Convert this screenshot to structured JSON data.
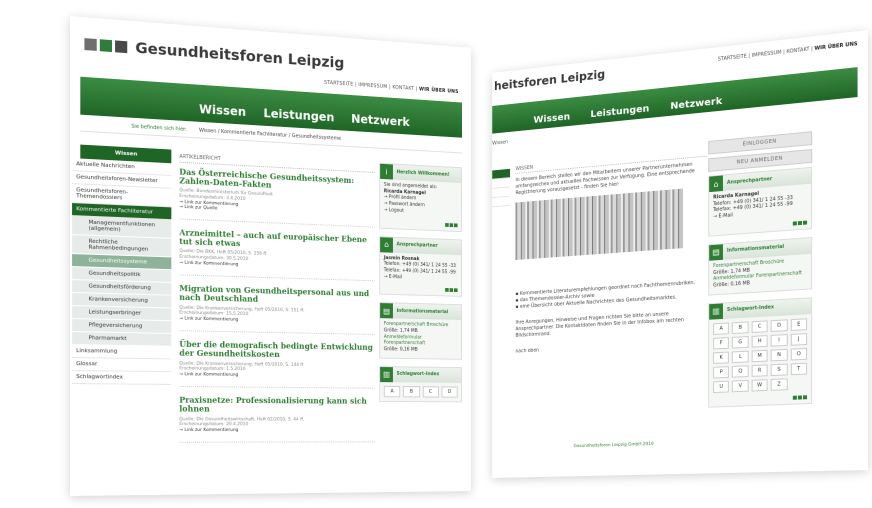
{
  "left": {
    "brand": "Gesundheitsforen Leipzig",
    "topnav": [
      "STARTSEITE",
      "IMPRESSUM",
      "KONTAKT",
      "WIR ÜBER UNS"
    ],
    "tabs": [
      "Wissen",
      "Leistungen",
      "Netzwerk"
    ],
    "crumb_label": "Sie befinden sich hier:",
    "crumb_path": "Wissen / Kommentierte Fachliteratur / Gesundheitssysteme",
    "nav_head": "Wissen",
    "nav": {
      "aktuelle": "Aktuelle Nachrichten",
      "newsletter": "Gesundheitsforen-Newsletter",
      "themen": "Gesundheitsforen-Themendossiers",
      "fachlit": "Kommentierte Fachliteratur",
      "sub1": "Managementfunktionen (allgemein)",
      "sub2": "Rechtliche Rahmenbedingungen",
      "sub3": "Gesundheitssysteme",
      "sub4": "Gesundheitspolitik",
      "sub5": "Gesundheitsförderung",
      "sub6": "Krankenversicherung",
      "sub7": "Leistungserbringer",
      "sub8": "Pflegeversicherung",
      "sub9": "Pharmamarkt",
      "links": "Linksammlung",
      "glossar": "Glossar",
      "schlagwort": "Schlagwortindex"
    },
    "section_label": "ARTIKELBERICHT",
    "articles": [
      {
        "title": "Das Österreichische Gesundheitssystem: Zahlen-Daten-Fakten",
        "meta": "Quelle: Bundesministerium für Gesundheit",
        "date": "Erscheinungsdatum: 3.4.2010",
        "link1": "Link zur Kommentierung",
        "link2": "Link zur Quelle"
      },
      {
        "title": "Arzneimittel – auch auf europäischer Ebene tut sich etwas",
        "meta": "Quelle: Die BKK, Heft 05/2010, S. 256 ff.",
        "date": "Erscheinungsdatum: 30.5.2010",
        "link1": "Link zur Kommentierung"
      },
      {
        "title": "Migration von Gesundheitspersonal aus und nach Deutschland",
        "meta": "Quelle: Die Krankenversicherung, Heft 05/2010, S. 151 ff.",
        "date": "Erscheinungsdatum: 15.5.2010",
        "link1": "Link zur Kommentierung"
      },
      {
        "title": "Über die demografisch bedingte Entwicklung der Gesundheitskosten",
        "meta": "Quelle: Die Krankenversicherung, Heft 05/2010, S. 144 ff.",
        "date": "Erscheinungsdatum: 1.5.2010",
        "link1": "Link zur Kommentierung"
      },
      {
        "title": "Praxisnetze: Professionalisierung kann sich lohnen",
        "meta": "Quelle: Die Gesundheitswirtschaft, Heft 02/2010, S. 44 ff.",
        "date": "Erscheinungsdatum: 20.4.2010",
        "link1": "Link zur Kommentierung"
      }
    ],
    "welcome": {
      "title": "Herzlich Willkommen!",
      "line1": "Sie sind angemeldet als:",
      "name": "Ricarda Karnagel",
      "p1": "Profil ändern",
      "p2": "Passwort ändern",
      "p3": "Logout"
    },
    "contact": {
      "title": "Ansprechpartner",
      "name": "Jasmin Rosnak",
      "tel": "Telefon: +49 (0) 341/ 1 24 55 -33",
      "fax": "Telefax: +49 (0) 341/ 1 24 55 -99",
      "mail": "E-Mail"
    },
    "info": {
      "title": "Informationsmaterial",
      "d1": "Forenpartnerschaft Broschüre",
      "s1": "Größe: 1,74 MB",
      "d2": "Anmeldeformular Forenpartnerschaft",
      "s2": "Größe: 0,16 MB"
    },
    "index": {
      "title": "Schlagwort-Index",
      "letters": [
        "A",
        "B",
        "C",
        "D"
      ]
    }
  },
  "right": {
    "brand": "heitsforen Leipzig",
    "topnav": [
      "STARTSEITE",
      "IMPRESSUM",
      "KONTAKT",
      "WIR ÜBER UNS"
    ],
    "tabs": [
      "Wissen",
      "Leistungen",
      "Netzwerk"
    ],
    "crumb": "Wissen",
    "wissen_label": "WISSEN",
    "intro": "In diesem Bereich stellen wir den Mitarbeitern unserer Partnerunternehmen umfangreiches und aktuelles Fachwissen zur Verfügung. Eine entsprechende Registrierung vorausgesetzt - finden Sie hier:",
    "bullets": [
      "Kommentierte Literaturempfehlungen geordnet nach Fachthemenrubriken,",
      "das Themendossier-Archiv sowie",
      "eine Übersicht über Aktuelle Nachrichten des Gesundheitsmarktes."
    ],
    "outro": "Ihre Anregungen, Hinweise und Fragen richten Sie bitte an unsere Ansprechpartner. Die Kontaktdaten finden Sie in der Infobox am rechten Bildschirmrand.",
    "top": "nach oben",
    "btn1": "EINLOGGEN",
    "btn2": "NEU ANMELDEN",
    "contact": {
      "title": "Ansprechpartner",
      "name": "Ricarda Karnagel",
      "tel": "Telefon: +49 (0) 341/ 1 24 55 -33",
      "fax": "Telefax: +49 (0) 341/ 1 24 55 -99",
      "mail": "E-Mail"
    },
    "info": {
      "title": "Informationsmaterial",
      "d1": "Forenpartnerschaft Broschüre",
      "s1": "Größe: 1,74 MB",
      "d2": "Anmeldeformular Forenpartnerschaft",
      "s2": "Größe: 0,16 MB"
    },
    "index": {
      "title": "Schlagwort-Index",
      "letters": [
        "A",
        "B",
        "C",
        "D",
        "E",
        "F",
        "G",
        "H",
        "I",
        "J",
        "K",
        "L",
        "M",
        "N",
        "O",
        "P",
        "Q",
        "R",
        "S",
        "T",
        "U",
        "V",
        "W",
        "Z"
      ]
    },
    "footer": "Gesundheitsforen Leipzig GmbH 2010"
  }
}
